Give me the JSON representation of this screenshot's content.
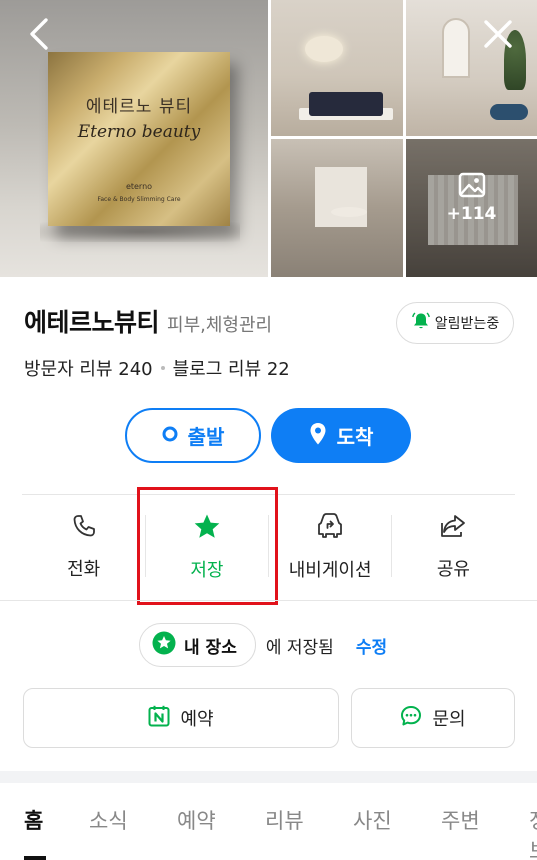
{
  "gallery": {
    "plaque_title": "에테르노 뷰티",
    "plaque_script": "Eterno beauty",
    "plaque_brand": "eterno",
    "plaque_caption": "Face & Body Slimming Care",
    "more_count": "+114"
  },
  "place": {
    "name": "에테르노뷰티",
    "category": "피부,체형관리",
    "alarm_label": "알림받는중",
    "visitor_reviews": "방문자 리뷰 240",
    "blog_reviews": "블로그 리뷰 22"
  },
  "route": {
    "start_label": "출발",
    "arrive_label": "도착"
  },
  "actions": [
    {
      "label": "전화",
      "icon": "phone-icon"
    },
    {
      "label": "저장",
      "icon": "star-icon"
    },
    {
      "label": "내비게이션",
      "icon": "car-navigation-icon"
    },
    {
      "label": "공유",
      "icon": "share-icon"
    }
  ],
  "saved": {
    "chip_label": "내 장소",
    "suffix": "에 저장됨",
    "edit_label": "수정"
  },
  "cta": {
    "book_label": "예약",
    "ask_label": "문의"
  },
  "tabs": [
    "홈",
    "소식",
    "예약",
    "리뷰",
    "사진",
    "주변",
    "정보"
  ],
  "colors": {
    "accent_blue": "#0e7ef5",
    "saved_green": "#03b24e",
    "highlight_red": "#e1121b"
  }
}
